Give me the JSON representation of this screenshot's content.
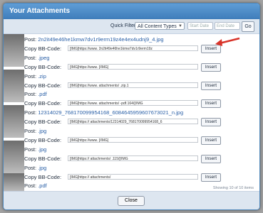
{
  "dialog": {
    "title": "Your Attachments"
  },
  "filter": {
    "label": "Quick Filter:",
    "selected": "All Content Types",
    "start_placeholder": "Start Date",
    "end_placeholder": "End Date",
    "go": "Go"
  },
  "labels": {
    "post": "Post:",
    "copy": "Copy BB-Code:",
    "insert": "Insert"
  },
  "rows": [
    {
      "kind": "post",
      "text": "2n2it49e46he1kmw7dv1r9erm19z4e4ex4udnj9_4.jpg"
    },
    {
      "kind": "code",
      "text": "[IMG]https://www.                                      2n2it49e46he1kmw7dv1r9erm19z"
    },
    {
      "kind": "post",
      "text": ".jpeg"
    },
    {
      "kind": "code",
      "text": "[IMG]https://www.                                                                    [/IMG]"
    },
    {
      "kind": "post",
      "text": ".zip"
    },
    {
      "kind": "code",
      "text": "[IMG]https://www.                                   attachments/                         .zip.1"
    },
    {
      "kind": "post",
      "text": ".pdf"
    },
    {
      "kind": "code",
      "text": "[IMG]https://www.                         attachments/                    -pdf.164/[/IMG"
    },
    {
      "kind": "post",
      "text": "12314029_768170099954168_6084645959607673021_n.jpg"
    },
    {
      "kind": "code",
      "text": "[IMG]https://                        attachments/12314029_768170099954168_6"
    },
    {
      "kind": "post",
      "text": ".jpg"
    },
    {
      "kind": "code",
      "text": "[IMG]https://www.                                                          [/IMG]"
    },
    {
      "kind": "post",
      "text": ".jpg"
    },
    {
      "kind": "code",
      "text": "[IMG]https://                        attachments/                   .115/[/IMG"
    },
    {
      "kind": "post",
      "text": ".jpg"
    },
    {
      "kind": "code",
      "text": "[IMG]https://                        attachments/                                   "
    },
    {
      "kind": "post",
      "text": ".pdf"
    }
  ],
  "footer": {
    "showing": "Showing 10 of 10 items",
    "close": "Close"
  },
  "annotation": {
    "color": "#d8342a"
  }
}
